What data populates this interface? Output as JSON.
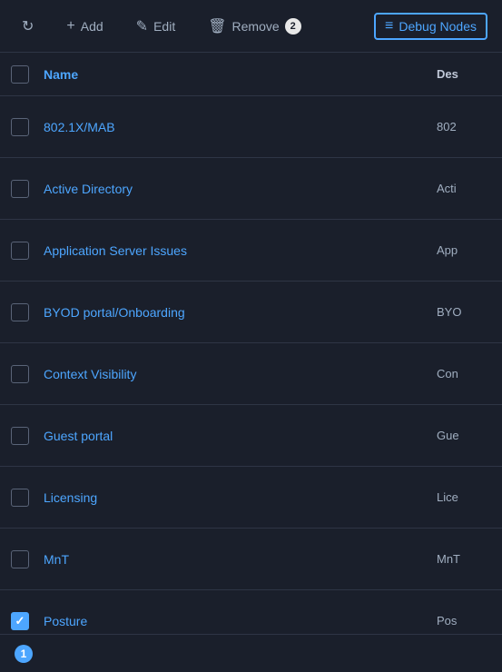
{
  "toolbar": {
    "add_label": "Add",
    "edit_label": "Edit",
    "remove_label": "Remove",
    "remove_count": "2",
    "debug_nodes_label": "Debug Nodes"
  },
  "table": {
    "headers": {
      "name": "Name",
      "description": "Des"
    },
    "rows": [
      {
        "id": 1,
        "name": "802.1X/MAB",
        "desc_short": "802",
        "checked": false
      },
      {
        "id": 2,
        "name": "Active Directory",
        "desc_short": "Acti",
        "checked": false
      },
      {
        "id": 3,
        "name": "Application Server Issues",
        "desc_short": "App",
        "checked": false
      },
      {
        "id": 4,
        "name": "BYOD portal/Onboarding",
        "desc_short": "BYO",
        "checked": false
      },
      {
        "id": 5,
        "name": "Context Visibility",
        "desc_short": "Con",
        "checked": false
      },
      {
        "id": 6,
        "name": "Guest portal",
        "desc_short": "Gue",
        "checked": false
      },
      {
        "id": 7,
        "name": "Licensing",
        "desc_short": "Lice",
        "checked": false
      },
      {
        "id": 8,
        "name": "MnT",
        "desc_short": "MnT",
        "checked": false
      },
      {
        "id": 9,
        "name": "Posture",
        "desc_short": "Pos",
        "checked": true
      }
    ]
  },
  "bottom": {
    "selected_count": "1"
  },
  "icons": {
    "refresh": "↻",
    "edit": "✎",
    "remove": "🗑",
    "debug": "≡",
    "check": "✓"
  }
}
